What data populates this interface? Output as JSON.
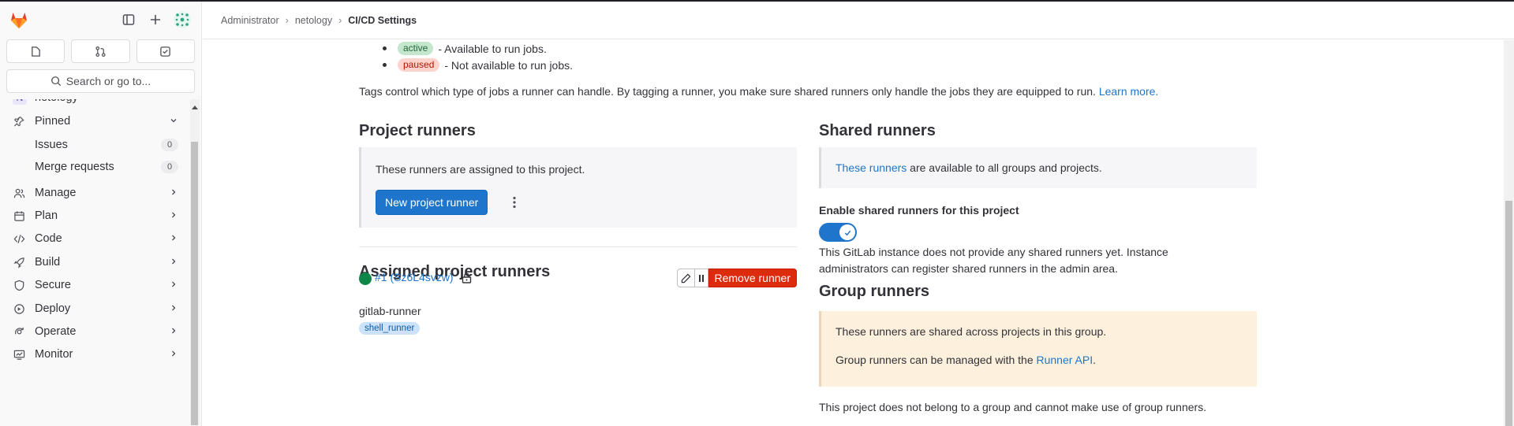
{
  "breadcrumb": [
    "Administrator",
    "netology",
    "CI/CD Settings"
  ],
  "sidebar": {
    "search_label": "Search or go to...",
    "project": {
      "initial": "N",
      "name": "netology"
    },
    "pinned": {
      "label": "Pinned",
      "items": [
        {
          "label": "Issues",
          "count": "0"
        },
        {
          "label": "Merge requests",
          "count": "0"
        }
      ]
    },
    "sections": [
      "Manage",
      "Plan",
      "Code",
      "Build",
      "Secure",
      "Deploy",
      "Operate",
      "Monitor"
    ]
  },
  "main": {
    "status": [
      {
        "badge": "active",
        "text": "- Available to run jobs."
      },
      {
        "badge": "paused",
        "text": "- Not available to run jobs."
      }
    ],
    "tags_note": "Tags control which type of jobs a runner can handle. By tagging a runner, you make sure shared runners only handle the jobs they are equipped to run.",
    "learn_more": "Learn more.",
    "project_runners": {
      "title": "Project runners",
      "description": "These runners are assigned to this project.",
      "new_button": "New project runner"
    },
    "assigned": {
      "title": "Assigned project runners",
      "runner_link": "#1 (Sz6L4svzw)",
      "remove_button": "Remove runner",
      "runner_name": "gitlab-runner",
      "tag": "shell_runner"
    },
    "shared": {
      "title": "Shared runners",
      "link": "These runners",
      "text": "are available to all groups and projects.",
      "toggle_label": "Enable shared runners for this project",
      "help": "This GitLab instance does not provide any shared runners yet. Instance administrators can register shared runners in the admin area."
    },
    "group": {
      "title": "Group runners",
      "line1": "These runners are shared across projects in this group.",
      "line2_prefix": "Group runners can be managed with the",
      "api_link": "Runner API",
      "line2_suffix": ".",
      "note": "This project does not belong to a group and cannot make use of group runners."
    }
  },
  "colors": {
    "accent": "#1f75cb",
    "danger": "#dd2b0e",
    "online": "#108548",
    "warning_bg": "#fdf1dd"
  }
}
